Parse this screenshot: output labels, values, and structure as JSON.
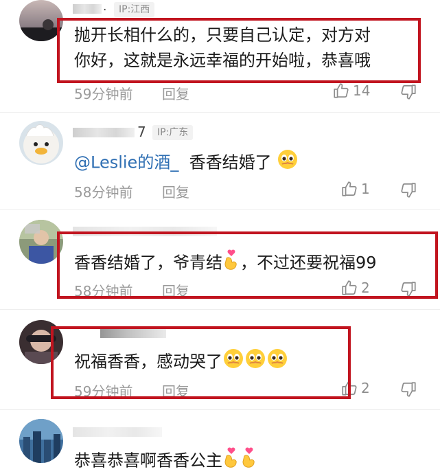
{
  "comments": [
    {
      "ip": "IP:江西",
      "text": "抛开长相什么的，只要自己认定，对方对你好，这就是永远幸福的开始啦，恭喜哦",
      "line1": "抛开长相什么的，只要自己认定，对方对",
      "line2": "你好，这就是永远幸福的开始啦，恭喜哦",
      "time": "59分钟前",
      "reply": "回复",
      "likes": "14"
    },
    {
      "name_tail": "7",
      "ip": "IP:广东",
      "mention": "@Leslie的酒_",
      "text": "香香结婚了",
      "emoji": "pleading-face",
      "time": "58分钟前",
      "reply": "回复",
      "likes": "1"
    },
    {
      "text_before": "香香结婚了，爷青结",
      "emoji": "finger-heart",
      "text_after": "，不过还要祝福99",
      "time": "58分钟前",
      "reply": "回复",
      "likes": "2"
    },
    {
      "text": "祝福香香，感动哭了",
      "emojis": [
        "pleading-face",
        "pleading-face",
        "pleading-face"
      ],
      "time": "59分钟前",
      "reply": "回复",
      "likes": "2"
    },
    {
      "text": "恭喜恭喜啊香香公主",
      "emojis": [
        "finger-heart",
        "finger-heart"
      ]
    }
  ],
  "colors": {
    "highlight_box": "#c1141f",
    "mention": "#2f6fb3",
    "meta": "#9a9a9a"
  }
}
